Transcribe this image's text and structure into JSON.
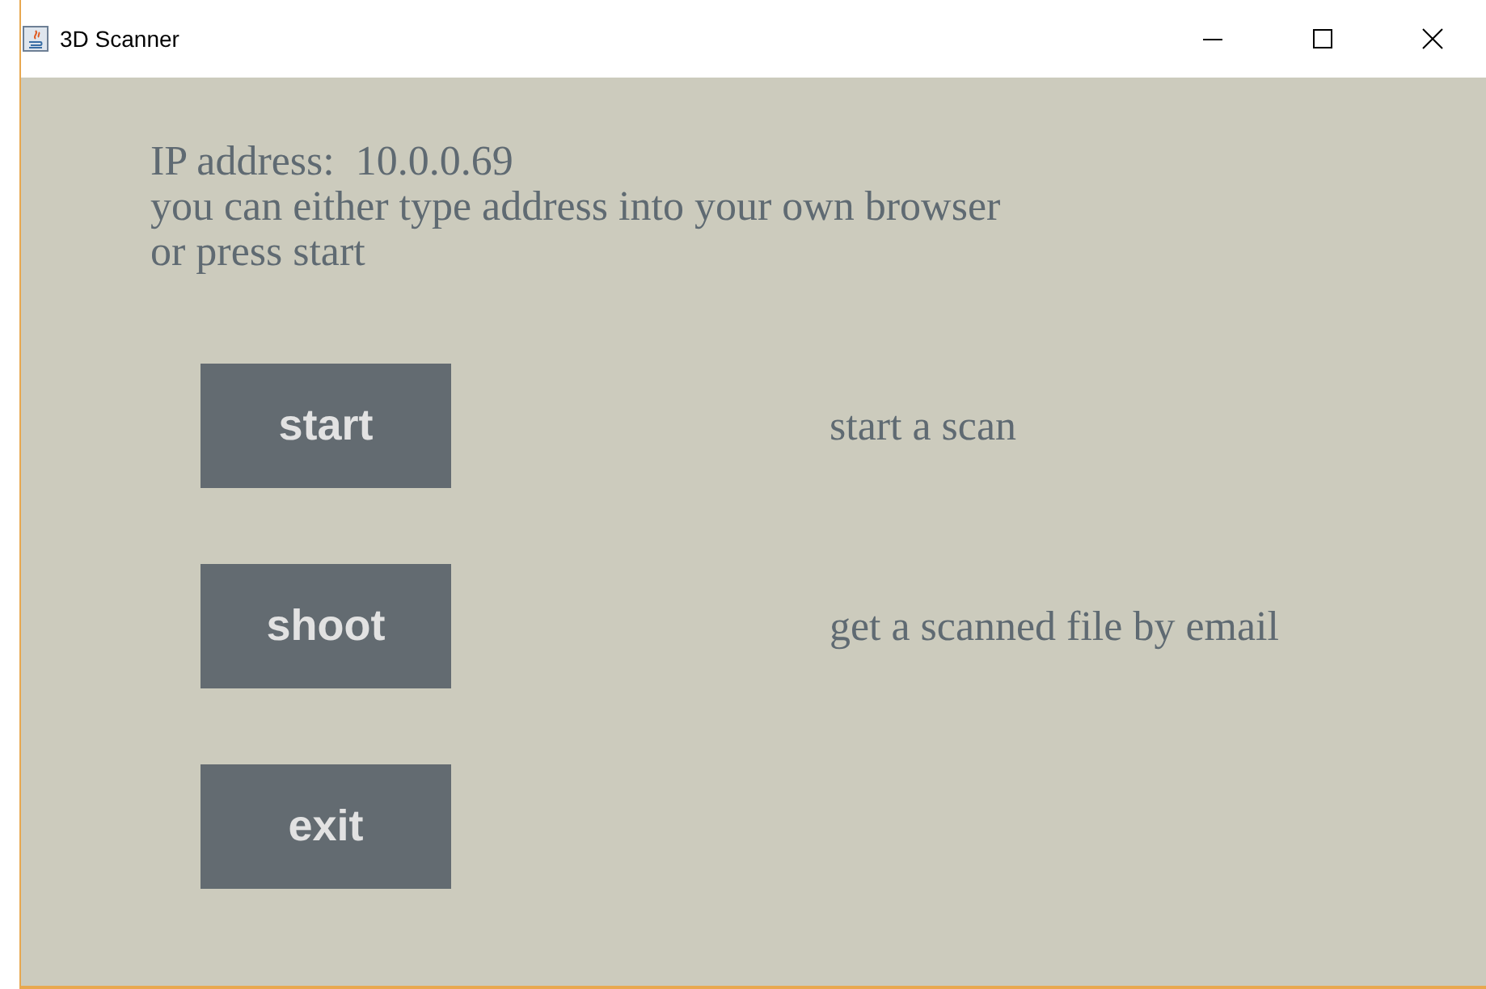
{
  "window": {
    "title": "3D Scanner"
  },
  "info": [
    "IP address:  10.0.0.69",
    "you can either type address into your own browser",
    "or press start"
  ],
  "actions": [
    {
      "label": "start",
      "description": "start a scan"
    },
    {
      "label": "shoot",
      "description": "get a scanned file by email"
    },
    {
      "label": "exit"
    }
  ]
}
